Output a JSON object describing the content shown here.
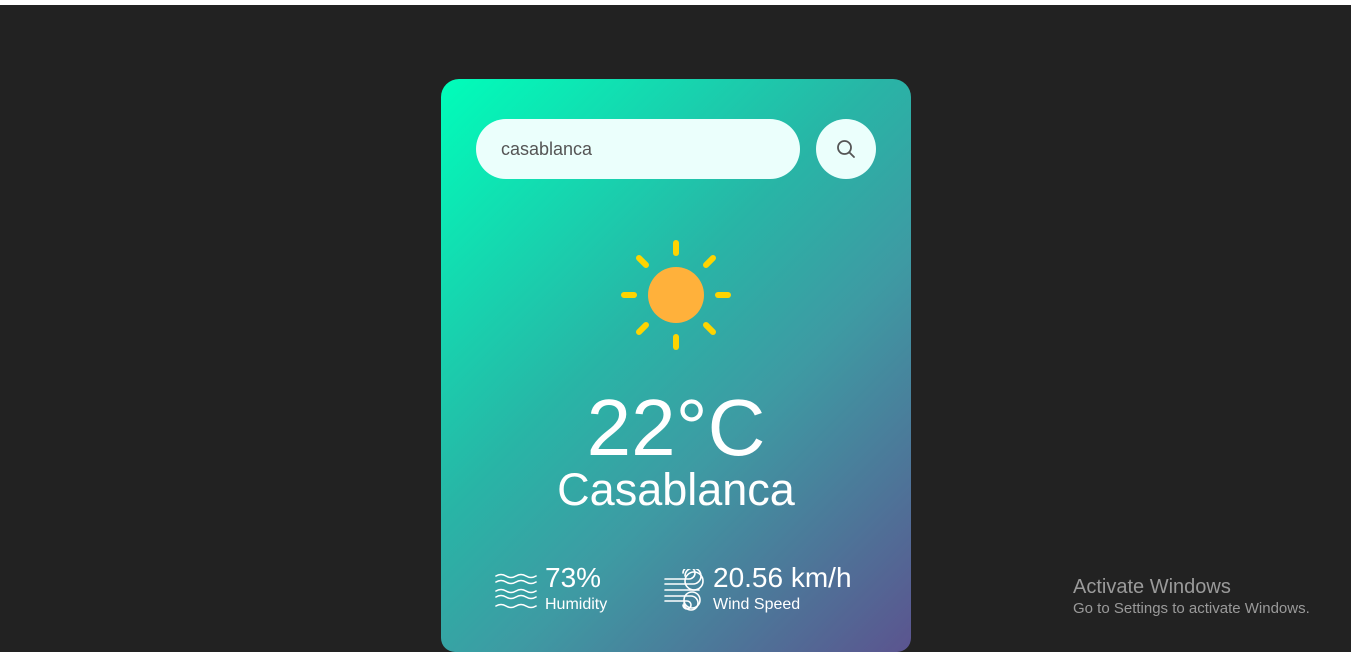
{
  "search": {
    "value": "casablanca"
  },
  "weather": {
    "icon": "sun-icon",
    "temperature": "22°C",
    "city": "Casablanca"
  },
  "details": {
    "humidity": {
      "value": "73%",
      "label": "Humidity",
      "icon": "humidity-icon"
    },
    "wind": {
      "value": "20.56 km/h",
      "label": "Wind Speed",
      "icon": "wind-icon"
    }
  },
  "watermark": {
    "title": "Activate Windows",
    "subtitle": "Go to Settings to activate Windows."
  },
  "colors": {
    "background": "#222222",
    "card_gradient_start": "#00feba",
    "card_gradient_end": "#5b548f",
    "input_background": "#ebfffc",
    "sun_ray": "#ffd400",
    "sun_body": "#ffb13b"
  }
}
